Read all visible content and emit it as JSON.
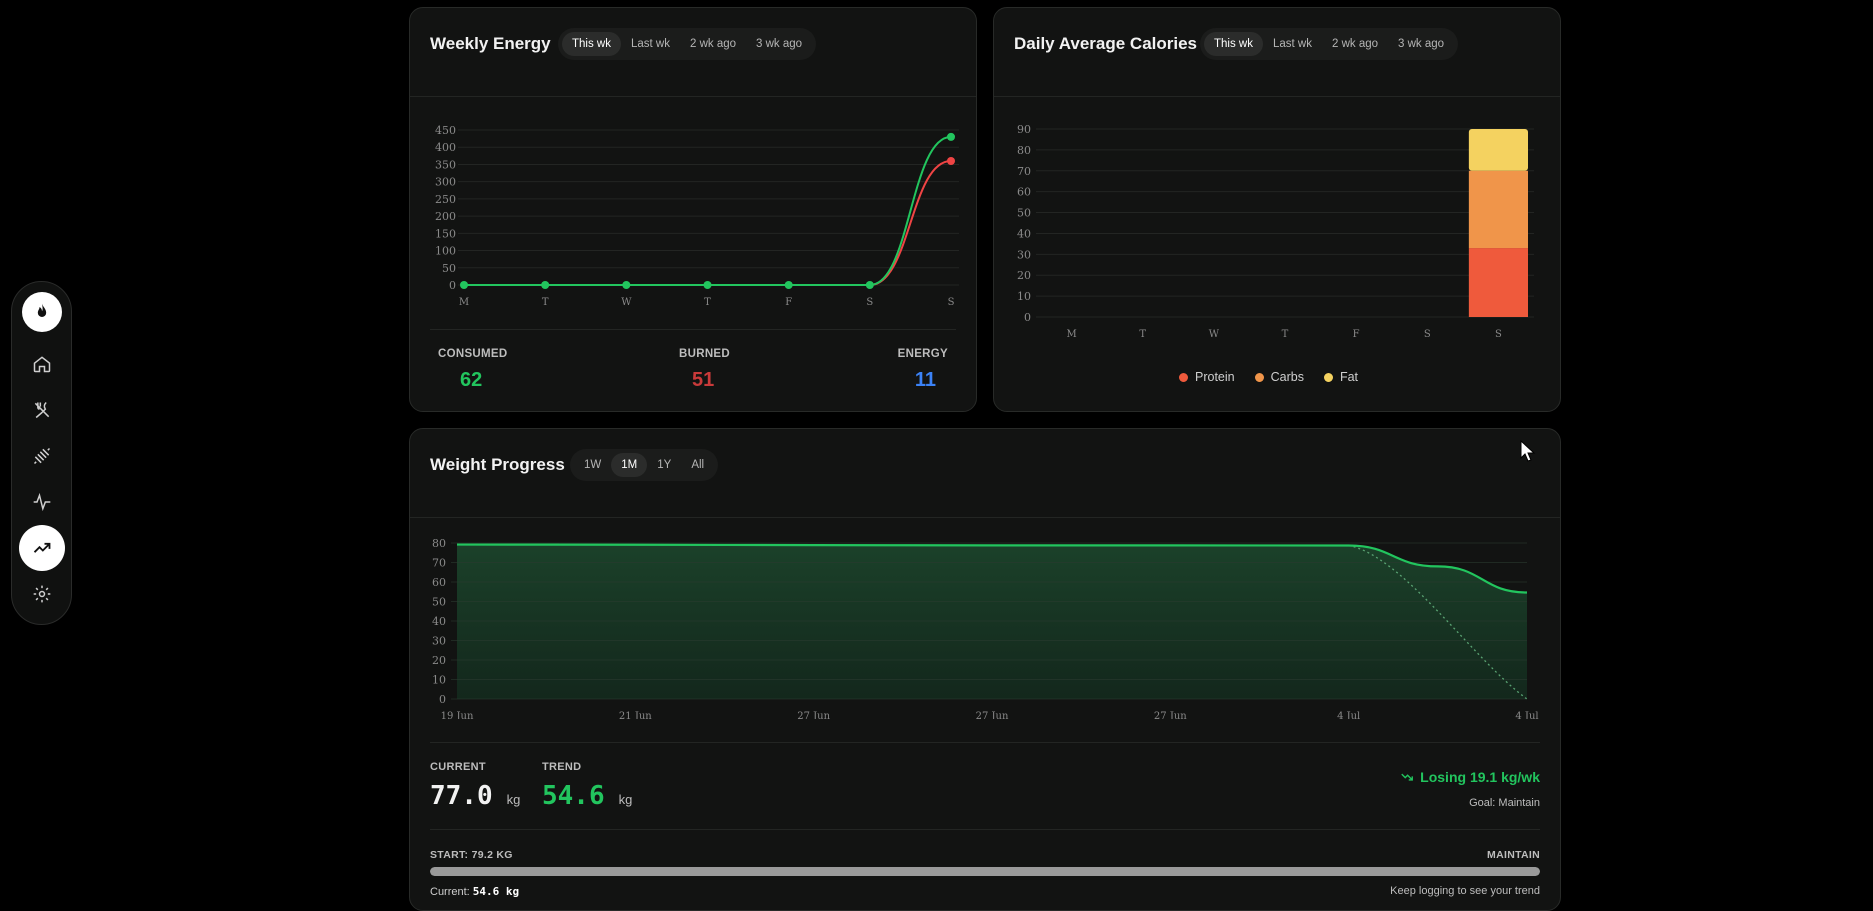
{
  "weekly_energy": {
    "title": "Weekly Energy",
    "tabs": [
      "This wk",
      "Last wk",
      "2 wk ago",
      "3 wk ago"
    ],
    "selected_tab": 0,
    "stats": {
      "consumed_label": "CONSUMED",
      "consumed_value": "62",
      "burned_label": "BURNED",
      "burned_value": "51",
      "energy_label": "ENERGY",
      "energy_value": "11"
    },
    "colors": {
      "consumed": "#22c55e",
      "burned": "#ef4444",
      "energy": "#3b82f6"
    }
  },
  "daily_calories": {
    "title": "Daily Average Calories",
    "tabs": [
      "This wk",
      "Last wk",
      "2 wk ago",
      "3 wk ago"
    ],
    "selected_tab": 0,
    "legend": [
      {
        "label": "Protein",
        "color": "#ef5a3c"
      },
      {
        "label": "Carbs",
        "color": "#f0954a"
      },
      {
        "label": "Fat",
        "color": "#f4d260"
      }
    ]
  },
  "weight_progress": {
    "title": "Weight Progress",
    "tabs": [
      "1W",
      "1M",
      "1Y",
      "All"
    ],
    "selected_tab": 1,
    "current_label": "CURRENT",
    "current_value": "77.0",
    "trend_label": "TREND",
    "trend_value": "54.6",
    "unit": "kg",
    "trend_text": "Losing 19.1 kg/wk",
    "goal_text": "Goal: Maintain",
    "start_text": "START: 79.2 KG",
    "maintain_text": "MAINTAIN",
    "current_footer_label": "Current: ",
    "current_footer_value": "54.6 kg",
    "hint_text": "Keep logging to see your trend",
    "progress_fraction": 1.0
  },
  "sidebar": {
    "icons": [
      "flame-icon",
      "home-icon",
      "utensils-icon",
      "dumbbell-icon",
      "activity-icon",
      "trending-up-icon",
      "gear-icon"
    ],
    "active_index": 5
  },
  "chart_data": [
    {
      "type": "line",
      "title": "Weekly Energy",
      "categories": [
        "M",
        "T",
        "W",
        "T",
        "F",
        "S",
        "S"
      ],
      "series": [
        {
          "values": [
            0,
            0,
            0,
            0,
            0,
            0,
            430
          ],
          "color": "#22c55e"
        },
        {
          "values": [
            0,
            0,
            0,
            0,
            0,
            0,
            360
          ],
          "color": "#ef4444"
        }
      ],
      "yticks": [
        0,
        50,
        100,
        150,
        200,
        250,
        300,
        350,
        400,
        450
      ],
      "ylim": [
        0,
        450
      ],
      "grid": true
    },
    {
      "type": "bar",
      "title": "Daily Average Calories",
      "stacked": true,
      "categories": [
        "M",
        "T",
        "W",
        "T",
        "F",
        "S",
        "S"
      ],
      "series": [
        {
          "name": "Protein",
          "values": [
            0,
            0,
            0,
            0,
            0,
            0,
            33
          ],
          "color": "#ef5a3c"
        },
        {
          "name": "Carbs",
          "values": [
            0,
            0,
            0,
            0,
            0,
            0,
            37
          ],
          "color": "#f0954a"
        },
        {
          "name": "Fat",
          "values": [
            0,
            0,
            0,
            0,
            0,
            0,
            20
          ],
          "color": "#f4d260"
        }
      ],
      "yticks": [
        0,
        10,
        20,
        30,
        40,
        50,
        60,
        70,
        80,
        90
      ],
      "ylim": [
        0,
        90
      ],
      "legend": "bottom",
      "grid": true
    },
    {
      "type": "area",
      "title": "Weight Progress",
      "xticks": [
        "19 Jun",
        "21 Jun",
        "27 Jun",
        "27 Jun",
        "27 Jun",
        "4 Jul",
        "4 Jul"
      ],
      "x": [
        0,
        1,
        2,
        3,
        4,
        5,
        5.5,
        6
      ],
      "y": [
        79.2,
        79.1,
        78.9,
        78.8,
        78.8,
        78.7,
        68,
        54.6
      ],
      "trend_x": [
        5,
        6
      ],
      "trend_y": [
        78.7,
        0
      ],
      "yticks": [
        0,
        10,
        20,
        30,
        40,
        50,
        60,
        70,
        80
      ],
      "ylim": [
        0,
        80
      ],
      "color": "#22c55e",
      "grid": true
    }
  ]
}
